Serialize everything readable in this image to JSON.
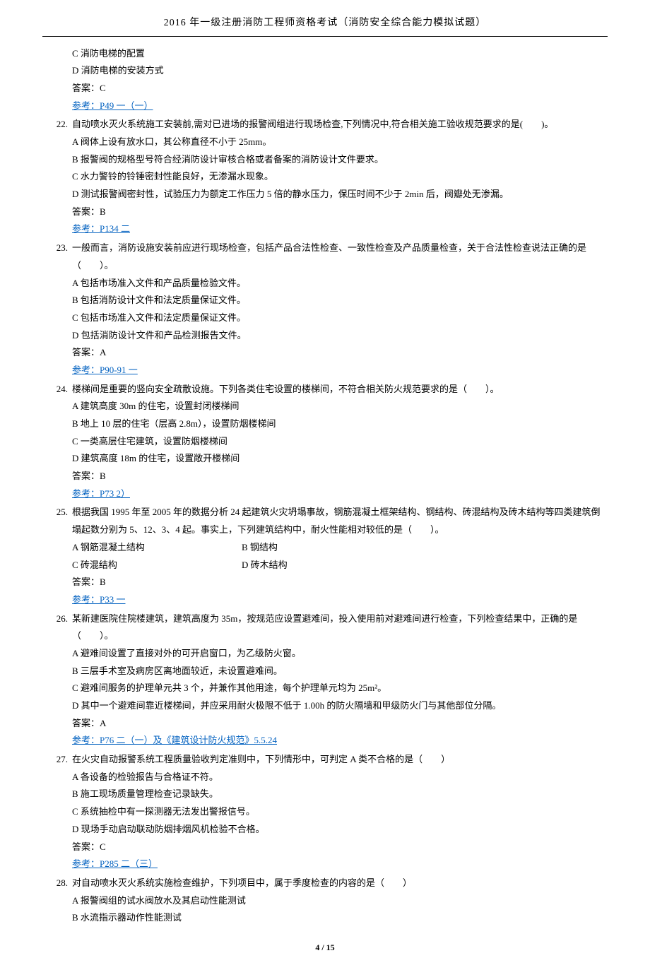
{
  "header": "2016 年一级注册消防工程师资格考试（消防安全综合能力模拟试题）",
  "partial": {
    "optC": "C 消防电梯的配置",
    "optD": "D 消防电梯的安装方式",
    "answer": "答案：C",
    "ref": "参考：P49 一（一）"
  },
  "q22": {
    "num": "22.",
    "stem": "自动喷水灭火系统施工安装前,需对已进场的报警阀组进行现场检查,下列情况中,符合相关施工验收规范要求的是(　　)。",
    "A": "A 阀体上设有放水口，其公称直径不小于 25mm。",
    "B": "B 报警阀的规格型号符合经消防设计审核合格或者备案的消防设计文件要求。",
    "C": "C 水力警铃的铃锤密封性能良好，无渗漏水现象。",
    "D": "D 测试报警阀密封性，试验压力为额定工作压力 5 倍的静水压力，保压时间不少于 2min 后，阀瓣处无渗漏。",
    "answer": "答案：B",
    "ref": "参考：P134 二"
  },
  "q23": {
    "num": "23.",
    "stem": "一般而言，消防设施安装前应进行现场检查，包括产品合法性检查、一致性检查及产品质量检查，关于合法性检查说法正确的是（　　）。",
    "A": "A 包括市场准入文件和产品质量检验文件。",
    "B": "B 包括消防设计文件和法定质量保证文件。",
    "C": "C 包括市场准入文件和法定质量保证文件。",
    "D": "D 包括消防设计文件和产品检测报告文件。",
    "answer": "答案：A",
    "ref": "参考：P90-91 一"
  },
  "q24": {
    "num": "24.",
    "stem": "楼梯间是重要的竖向安全疏散设施。下列各类住宅设置的楼梯间，不符合相关防火规范要求的是（　　）。",
    "A": "A 建筑高度 30m 的住宅，设置封闭楼梯间",
    "B": "B 地上 10 层的住宅（层高 2.8m），设置防烟楼梯间",
    "C": "C 一类高层住宅建筑，设置防烟楼梯间",
    "D": "D 建筑高度 18m 的住宅，设置敞开楼梯间",
    "answer": "答案：B",
    "ref": "参考：P73 2）"
  },
  "q25": {
    "num": "25.",
    "stem": "根据我国 1995 年至 2005 年的数据分析 24 起建筑火灾坍塌事故，钢筋混凝土框架结构、钢结构、砖混结构及砖木结构等四类建筑倒塌起数分别为 5、12、3、4 起。事实上，下列建筑结构中，耐火性能相对较低的是（　　）。",
    "A": "A 钢筋混凝土结构",
    "B": "B 钢结构",
    "C": "C 砖混结构",
    "D": "D 砖木结构",
    "answer": "答案：B",
    "ref": "参考：P33 一"
  },
  "q26": {
    "num": "26.",
    "stem": "某新建医院住院楼建筑，建筑高度为 35m，按规范应设置避难间，投入使用前对避难间进行检查，下列检查结果中，正确的是（　　）。",
    "A": "A 避难间设置了直接对外的可开启窗口，为乙级防火窗。",
    "B": "B 三层手术室及病房区离地面较近，未设置避难间。",
    "C": "C 避难间服务的护理单元共 3 个，并兼作其他用途，每个护理单元均为 25m²。",
    "D": "D 其中一个避难间靠近楼梯间，并应采用耐火极限不低于 1.00h 的防火隔墙和甲级防火门与其他部位分隔。",
    "answer": "答案：A",
    "ref": "参考：P76 二（一）及《建筑设计防火规范》5.5.24"
  },
  "q27": {
    "num": "27.",
    "stem": "在火灾自动报警系统工程质量验收判定准则中，下列情形中，可判定 A 类不合格的是（　　）",
    "A": "A 各设备的检验报告与合格证不符。",
    "B": "B 施工现场质量管理检查记录缺失。",
    "C": "C 系统抽检中有一探测器无法发出警报信号。",
    "D": "D 现场手动启动联动防烟排烟风机检验不合格。",
    "answer": "答案：C",
    "ref": "参考：P285 二（三）"
  },
  "q28": {
    "num": "28.",
    "stem": "对自动喷水灭火系统实施检查维护，下列项目中，属于季度检查的内容的是（　　）",
    "A": "A 报警阀组的试水阀放水及其启动性能测试",
    "B": "B 水流指示器动作性能测试"
  },
  "footer": "4 / 15"
}
